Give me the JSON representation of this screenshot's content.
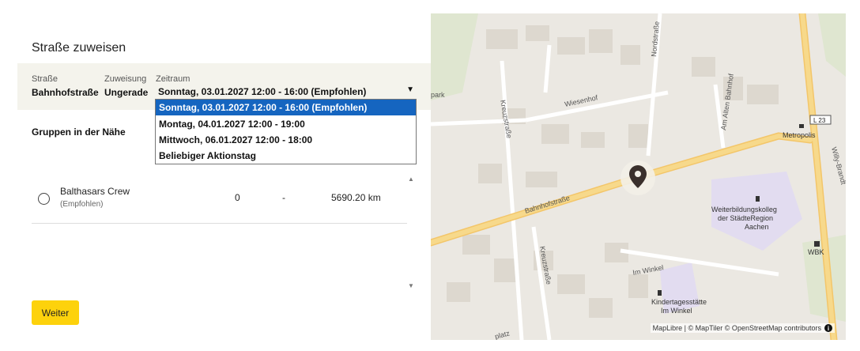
{
  "dialog": {
    "title": "Straße zuweisen"
  },
  "street_bar": {
    "street_label": "Straße",
    "street_value": "Bahnhofstraße",
    "assignment_label": "Zuweisung",
    "assignment_value": "Ungerade",
    "period_label": "Zeitraum",
    "period_selected": "Sonntag, 03.01.2027 12:00 - 16:00 (Empfohlen)"
  },
  "period_options": [
    "Sonntag, 03.01.2027 12:00 - 16:00 (Empfohlen)",
    "Montag, 04.01.2027 12:00 - 19:00",
    "Mittwoch, 06.01.2027 12:00 - 18:00",
    "Beliebiger Aktionstag"
  ],
  "nearby": {
    "heading": "Gruppen in der Nähe"
  },
  "groups": [
    {
      "name": "Balthasars Crew",
      "note": "(Empfohlen)",
      "count": "0",
      "dash": "-",
      "distance": "5690.20 km"
    }
  ],
  "actions": {
    "next_label": "Weiter"
  },
  "map": {
    "labels": {
      "nordstrasse": "Nordstraße",
      "kreuzstrasse_1": "Kreuzstraße",
      "kreuzstrasse_2": "Kreuzstraße",
      "wiesenhof": "Wiesenhof",
      "am_alten_bahnhof": "Am Alten Bahnhof",
      "park": "park",
      "bahnhofstrasse": "Bahnhofstraße",
      "im_winkel": "Im Winkel",
      "platz": "platz",
      "willy_brandt": "Willy-Brandt",
      "l23": "L 23",
      "metropolis": "Metropolis",
      "weiterbildung_1": "Weiterbildungskolleg",
      "weiterbildung_2": "der StädteRegion",
      "weiterbildung_3": "Aachen",
      "wbk": "WBK",
      "kita_1": "Kindertagesstätte",
      "kita_2": "Im Winkel"
    },
    "attribution": "MapLibre | © MapTiler © OpenStreetMap contributors",
    "info_glyph": "i"
  },
  "colors": {
    "accent": "#fdd20c",
    "selected_option": "#1565c0",
    "road": "#f7d98b",
    "map_bg": "#ebe8e2",
    "park": "#dfe6d0",
    "poi_area": "#e2dcf0"
  }
}
